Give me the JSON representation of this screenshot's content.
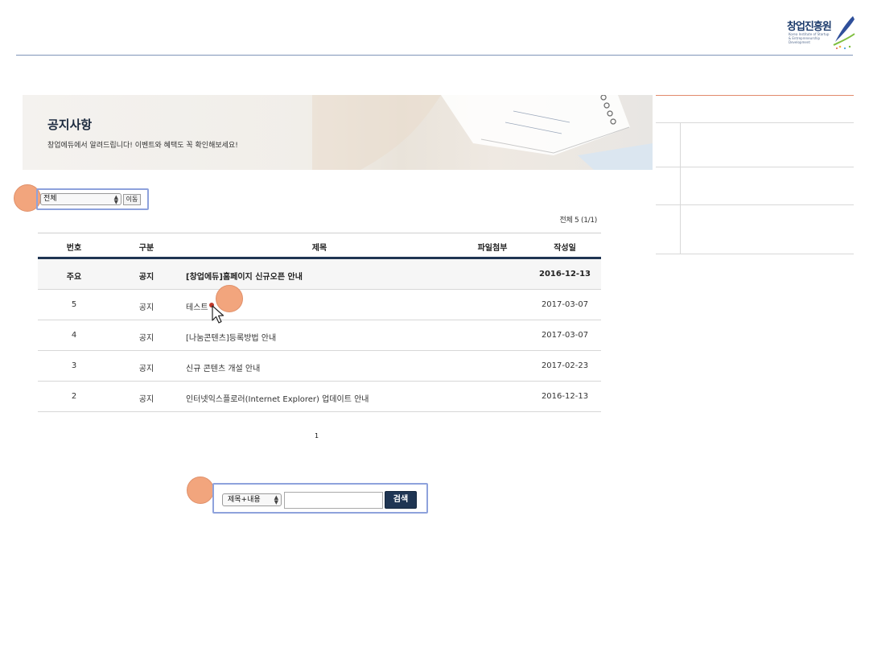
{
  "header": {
    "logo_title": "창업진흥원",
    "logo_subtitle": "Korea Institute of Startup & Entrepreneurship Development"
  },
  "banner": {
    "title": "공지사항",
    "subtitle": "창업에듀에서 알려드립니다! 이벤트와 혜택도 꼭 확인해보세요!"
  },
  "filter": {
    "category_selected": "전체",
    "go_label": "이동"
  },
  "total_text": "전체 5 (1/1)",
  "table": {
    "headers": [
      "번호",
      "구분",
      "제목",
      "파일첨부",
      "작성일"
    ],
    "rows": [
      {
        "num": "주요",
        "category": "공지",
        "title": "[창업에듀]홈페이지 신규오픈 안내",
        "date": "2016-12-13"
      },
      {
        "num": "5",
        "category": "공지",
        "title": "테스트",
        "date": "2017-03-07"
      },
      {
        "num": "4",
        "category": "공지",
        "title": "[나눔콘텐츠]등록방법 안내",
        "date": "2017-03-07"
      },
      {
        "num": "3",
        "category": "공지",
        "title": "신규 콘텐츠 개설 안내",
        "date": "2017-02-23"
      },
      {
        "num": "2",
        "category": "공지",
        "title": "인터넷익스플로러(Internet Explorer) 업데이트 안내",
        "date": "2016-12-13"
      }
    ]
  },
  "pagination": {
    "current": "1"
  },
  "search": {
    "field_selected": "제목+내용",
    "query": "",
    "button_label": "검색"
  },
  "colors": {
    "navy": "#1f3553",
    "marker": "#f2a57d",
    "highlight": "#8ea2dc"
  },
  "icons": [
    "logo-swoosh-icon",
    "select-arrows-icon",
    "mouse-cursor-icon"
  ]
}
